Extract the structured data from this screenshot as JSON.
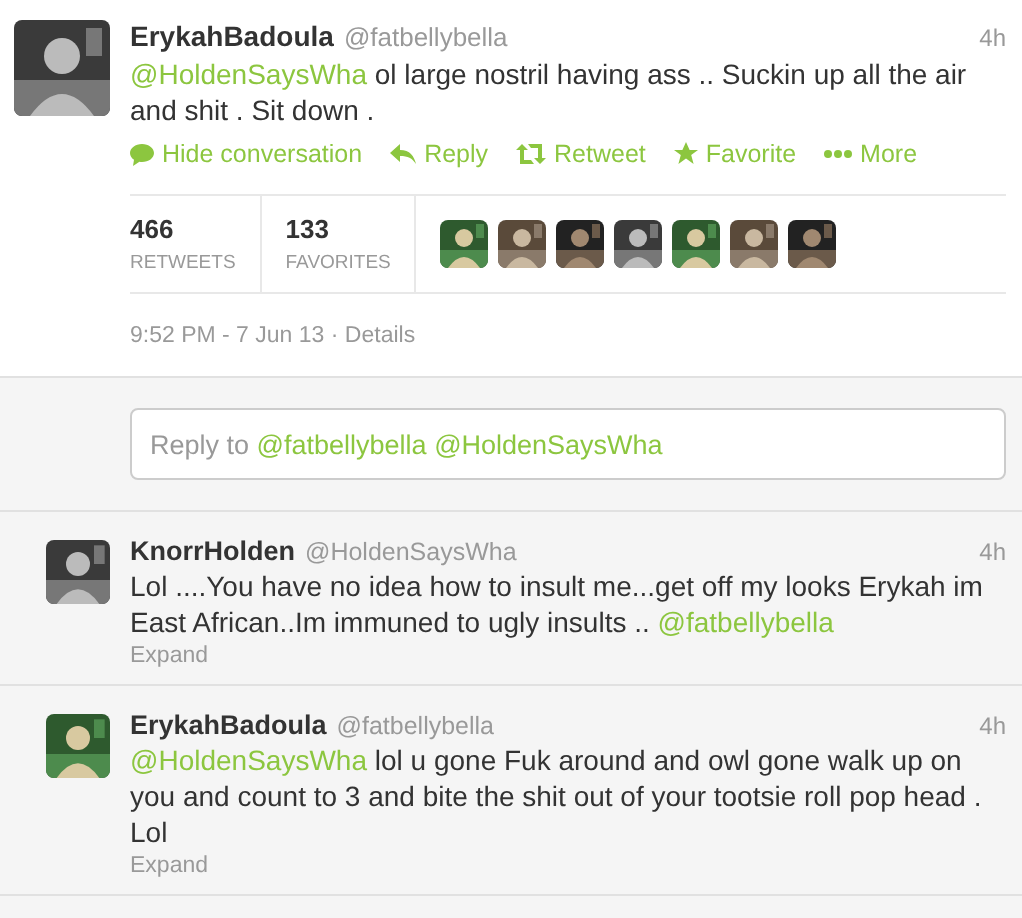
{
  "main_tweet": {
    "name": "ErykahBadoula",
    "handle": "@fatbellybella",
    "time": "4h",
    "body": [
      {
        "kind": "mention",
        "text": "@HoldenSaysWha"
      },
      {
        "kind": "text",
        "text": " ol large nostril having ass .. Suckin up all the air and shit . Sit down ."
      }
    ],
    "actions": [
      {
        "kind": "conversation",
        "label": "Hide conversation"
      },
      {
        "kind": "reply",
        "label": "Reply"
      },
      {
        "kind": "retweet",
        "label": "Retweet"
      },
      {
        "kind": "favorite",
        "label": "Favorite"
      },
      {
        "kind": "more",
        "label": "More"
      }
    ],
    "stats": [
      {
        "count": "466",
        "label": "RETWEETS"
      },
      {
        "count": "133",
        "label": "FAVORITES"
      }
    ],
    "timestamp": "9:52 PM - 7 Jun 13",
    "separator": "·",
    "details": "Details"
  },
  "reply_box": {
    "prefix": "Reply to",
    "mentions": [
      "@fatbellybella",
      "@HoldenSaysWha"
    ]
  },
  "replies": [
    {
      "name": "KnorrHolden",
      "handle": "@HoldenSaysWha",
      "time": "4h",
      "body": [
        {
          "kind": "text",
          "text": "Lol ....You have no idea how to insult me...get off my looks Erykah im East African..Im immuned to ugly insults .. "
        },
        {
          "kind": "mention",
          "text": "@fatbellybella"
        }
      ],
      "expand": "Expand"
    },
    {
      "name": "ErykahBadoula",
      "handle": "@fatbellybella",
      "time": "4h",
      "body": [
        {
          "kind": "mention",
          "text": "@HoldenSaysWha"
        },
        {
          "kind": "text",
          "text": " lol u gone Fuk around and owl gone walk up on you and count to 3 and bite the shit out of your tootsie roll pop head . Lol"
        }
      ],
      "expand": "Expand"
    }
  ]
}
